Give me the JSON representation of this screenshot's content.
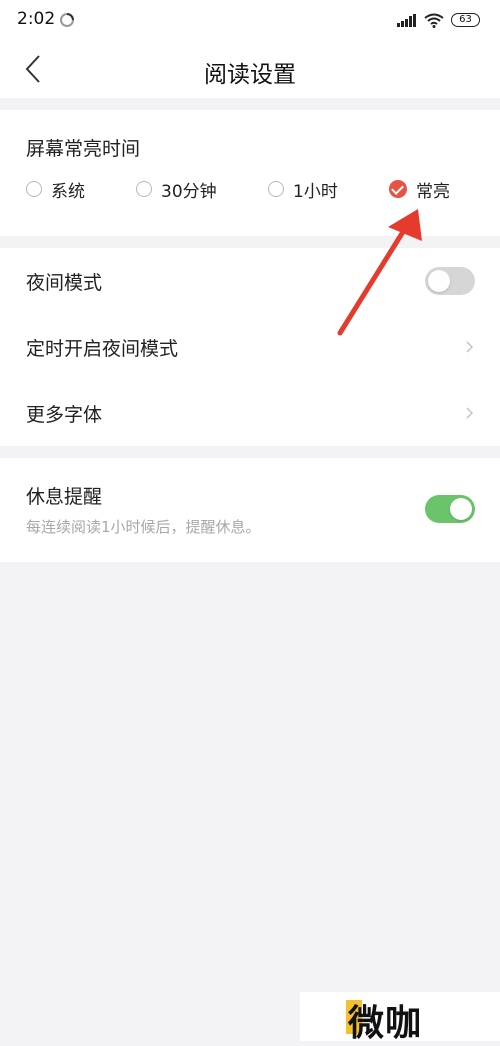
{
  "status_bar": {
    "time": "2:02",
    "battery": "63"
  },
  "header": {
    "title": "阅读设置"
  },
  "screen_on": {
    "label": "屏幕常亮时间",
    "options": [
      {
        "label": "系统",
        "selected": false
      },
      {
        "label": "30分钟",
        "selected": false
      },
      {
        "label": "1小时",
        "selected": false
      },
      {
        "label": "常亮",
        "selected": true
      }
    ]
  },
  "settings": {
    "night_mode": {
      "label": "夜间模式",
      "enabled": false
    },
    "scheduled_night_mode": {
      "label": "定时开启夜间模式"
    },
    "more_fonts": {
      "label": "更多字体"
    }
  },
  "rest_reminder": {
    "title": "休息提醒",
    "description": "每连续阅读1小时候后，提醒休息。",
    "enabled": true
  },
  "annotation": {
    "arrow_color": "#e53b2c"
  },
  "colors": {
    "accent_red": "#e85143",
    "toggle_green": "#6cc46a",
    "toggle_off": "#d6d6d6"
  },
  "watermark": {
    "text": "微咖"
  }
}
